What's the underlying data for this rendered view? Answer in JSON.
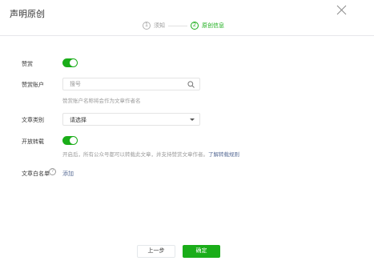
{
  "dialog": {
    "title": "声明原创",
    "close_icon": "close-icon"
  },
  "steps": [
    {
      "num": "1",
      "label": "须知",
      "state": "done"
    },
    {
      "num": "2",
      "label": "原创信息",
      "state": "active"
    }
  ],
  "form": {
    "reward": {
      "label": "赞赏",
      "enabled": true
    },
    "reward_account": {
      "label": "赞赏账户",
      "placeholder": "搜号",
      "value": "",
      "hint": "赞赏账户名称将会作为文章作者名"
    },
    "category": {
      "label": "文章类别",
      "selected": "请选择"
    },
    "repost": {
      "label": "开放转载",
      "enabled": true,
      "hint": "开启后，所有公众号都可以转载此文章，并支持赞赏文章作者。",
      "hint_link": "了解转载规则"
    },
    "whitelist": {
      "label": "文章白名单",
      "help_glyph": "?",
      "add_link": "添加"
    }
  },
  "footer": {
    "prev_label": "上一步",
    "ok_label": "确定"
  },
  "colors": {
    "accent": "#1aad19",
    "link": "#576b95",
    "muted": "#9a9a9a"
  }
}
